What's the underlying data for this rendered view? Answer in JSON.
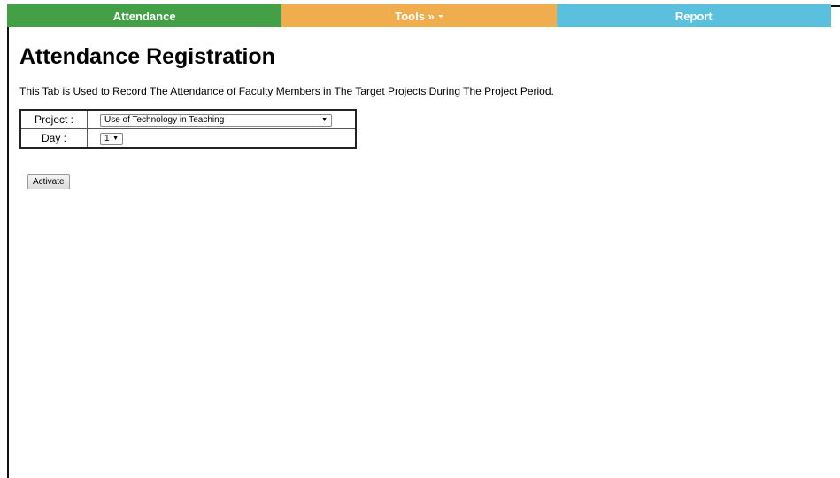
{
  "navbar": {
    "attendance": "Attendance",
    "tools": "Tools »",
    "report": "Report",
    "colors": {
      "attendance": "#43a047",
      "tools": "#f0ad4e",
      "report": "#5bc0de"
    }
  },
  "page": {
    "title": "Attendance Registration",
    "description": "This Tab is Used to Record The Attendance of Faculty Members in The Target Projects During The Project Period."
  },
  "form": {
    "project_label": "Project :",
    "project_value": "Use of Technology in Teaching",
    "day_label": "Day :",
    "day_value": "1",
    "activate_label": "Activate"
  }
}
